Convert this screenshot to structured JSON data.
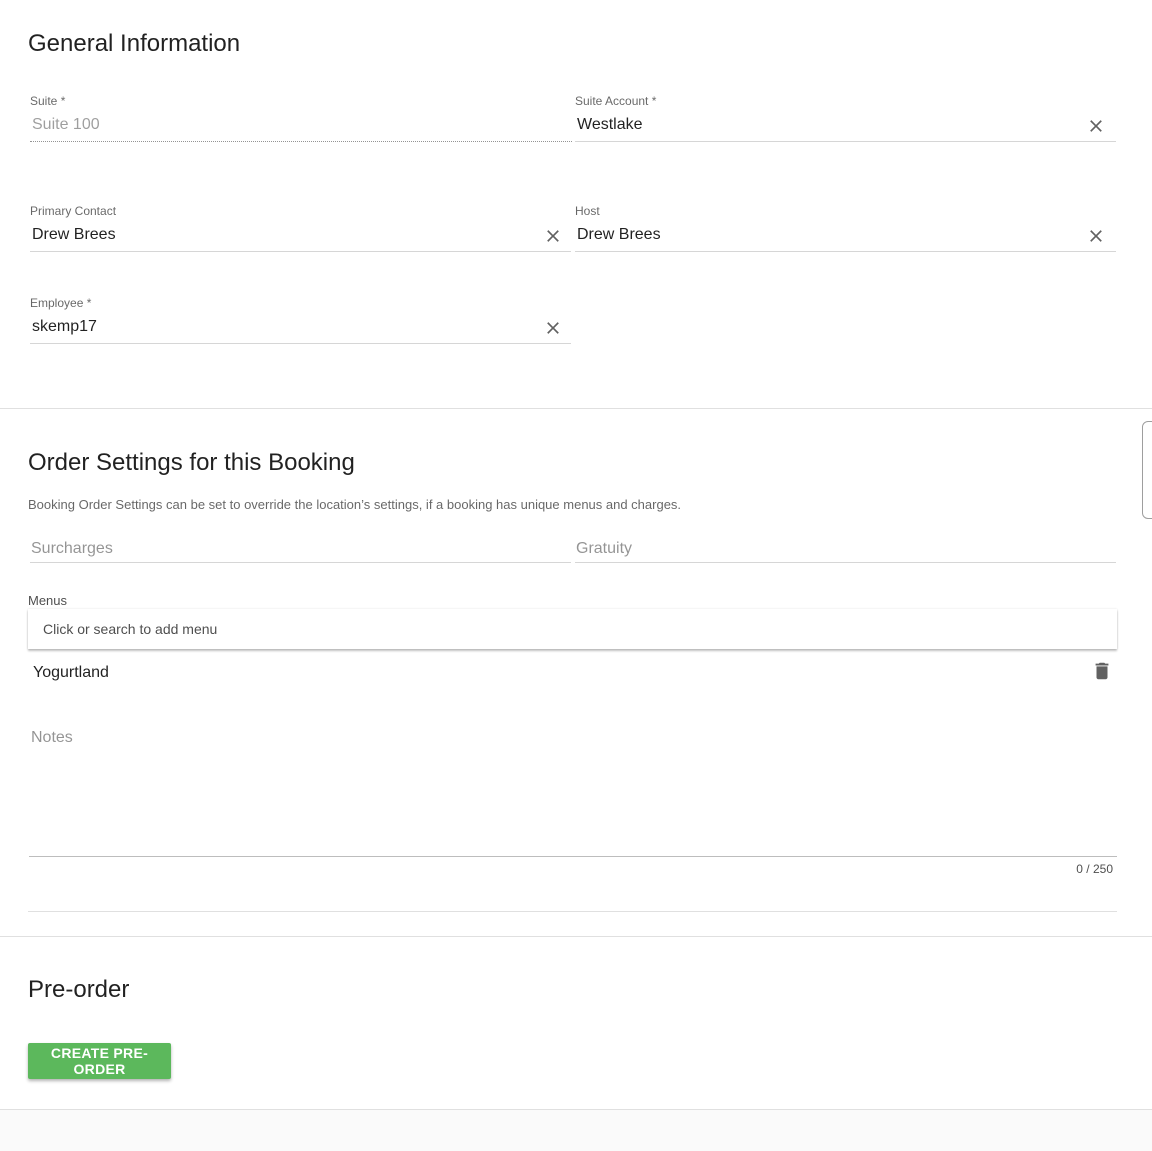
{
  "general": {
    "title": "General Information",
    "suite": {
      "label": "Suite",
      "required": "*",
      "value": "Suite 100"
    },
    "suite_account": {
      "label": "Suite Account",
      "required": "*",
      "value": "Westlake"
    },
    "primary_contact": {
      "label": "Primary Contact",
      "value": "Drew Brees"
    },
    "host": {
      "label": "Host",
      "value": "Drew Brees"
    },
    "employee": {
      "label": "Employee",
      "required": "*",
      "value": "skemp17"
    }
  },
  "order_settings": {
    "title": "Order Settings for this Booking",
    "helper": "Booking Order Settings can be set to override the location’s settings, if a booking has unique menus and charges.",
    "surcharges_placeholder": "Surcharges",
    "gratuity_placeholder": "Gratuity",
    "menus_label": "Menus",
    "menu_search_placeholder": "Click or search to add menu",
    "menus": [
      "Yogurtland"
    ],
    "notes_label": "Notes",
    "notes_counter": "0 / 250"
  },
  "preorder": {
    "title": "Pre-order",
    "button_label": "CREATE PRE-ORDER"
  },
  "icons": {
    "clear": "close-icon",
    "delete": "trash-icon"
  },
  "colors": {
    "primary_button": "#5cb85c"
  }
}
